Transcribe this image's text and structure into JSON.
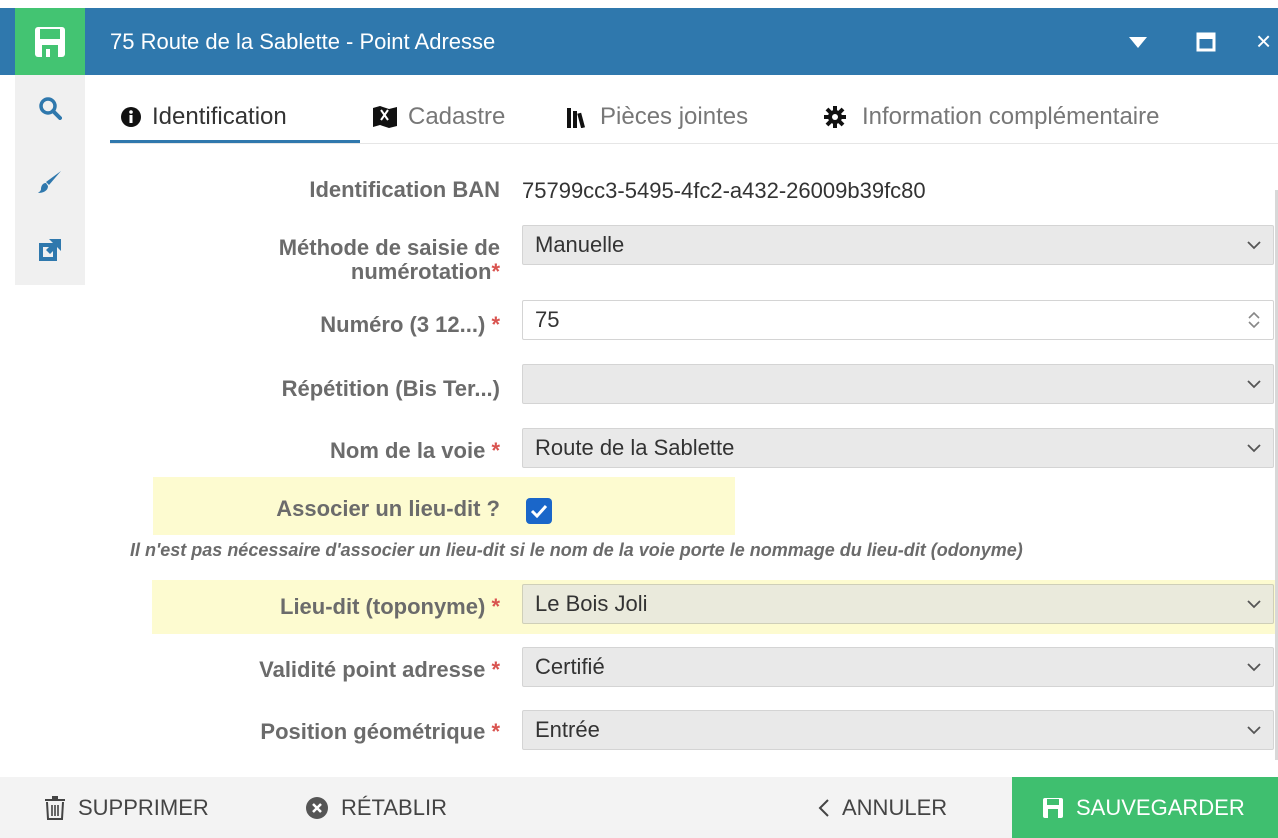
{
  "window": {
    "title": "75 Route de la Sablette - Point Adresse",
    "title_icon": "floppy-disk-icon",
    "menu_icon": "caret-down-icon",
    "restore_icon": "window-restore-icon",
    "close_label": "×"
  },
  "left_toolbar": [
    {
      "icon": "search-icon"
    },
    {
      "icon": "brush-icon"
    },
    {
      "icon": "external-link-icon"
    }
  ],
  "tabs": [
    {
      "label": "Identification",
      "icon": "info-circle-icon",
      "active": true
    },
    {
      "label": "Cadastre",
      "icon": "map-icon",
      "active": false
    },
    {
      "label": "Pièces jointes",
      "icon": "library-icon",
      "active": false
    },
    {
      "label": "Information complémentaire",
      "icon": "cog-icon",
      "active": false
    }
  ],
  "form": {
    "identification_ban": {
      "label": "Identification BAN",
      "value": "75799cc3-5495-4fc2-a432-26009b39fc80"
    },
    "methode": {
      "label_line1": "Méthode de saisie de",
      "label_line2": "numérotation",
      "required": "*",
      "value": "Manuelle"
    },
    "numero": {
      "label": "Numéro (3 12...)",
      "required": "*",
      "value": "75"
    },
    "repetition": {
      "label": "Répétition (Bis Ter...)",
      "value": ""
    },
    "nom_voie": {
      "label": "Nom de la voie",
      "required": "*",
      "value": "Route de la Sablette"
    },
    "associer": {
      "label": "Associer un lieu-dit ?",
      "checked": true
    },
    "help_text": "Il n'est pas nécessaire d'associer un lieu-dit si le nom de la voie porte le nommage du lieu-dit (odonyme)",
    "lieu_dit": {
      "label": "Lieu-dit (toponyme)",
      "required": "*",
      "value": "Le Bois Joli"
    },
    "validite": {
      "label": "Validité point adresse",
      "required": "*",
      "value": "Certifié"
    },
    "position": {
      "label": "Position géométrique",
      "required": "*",
      "value": "Entrée"
    }
  },
  "footer": {
    "delete_label": "SUPPRIMER",
    "reset_label": "RÉTABLIR",
    "cancel_label": "ANNULER",
    "save_label": "SAUVEGARDER"
  },
  "colors": {
    "titlebar": "#2f78ad",
    "save_green": "#43c472",
    "highlight": "#fdfbd0",
    "required": "#d9534f",
    "checkbox": "#1a66c9"
  }
}
